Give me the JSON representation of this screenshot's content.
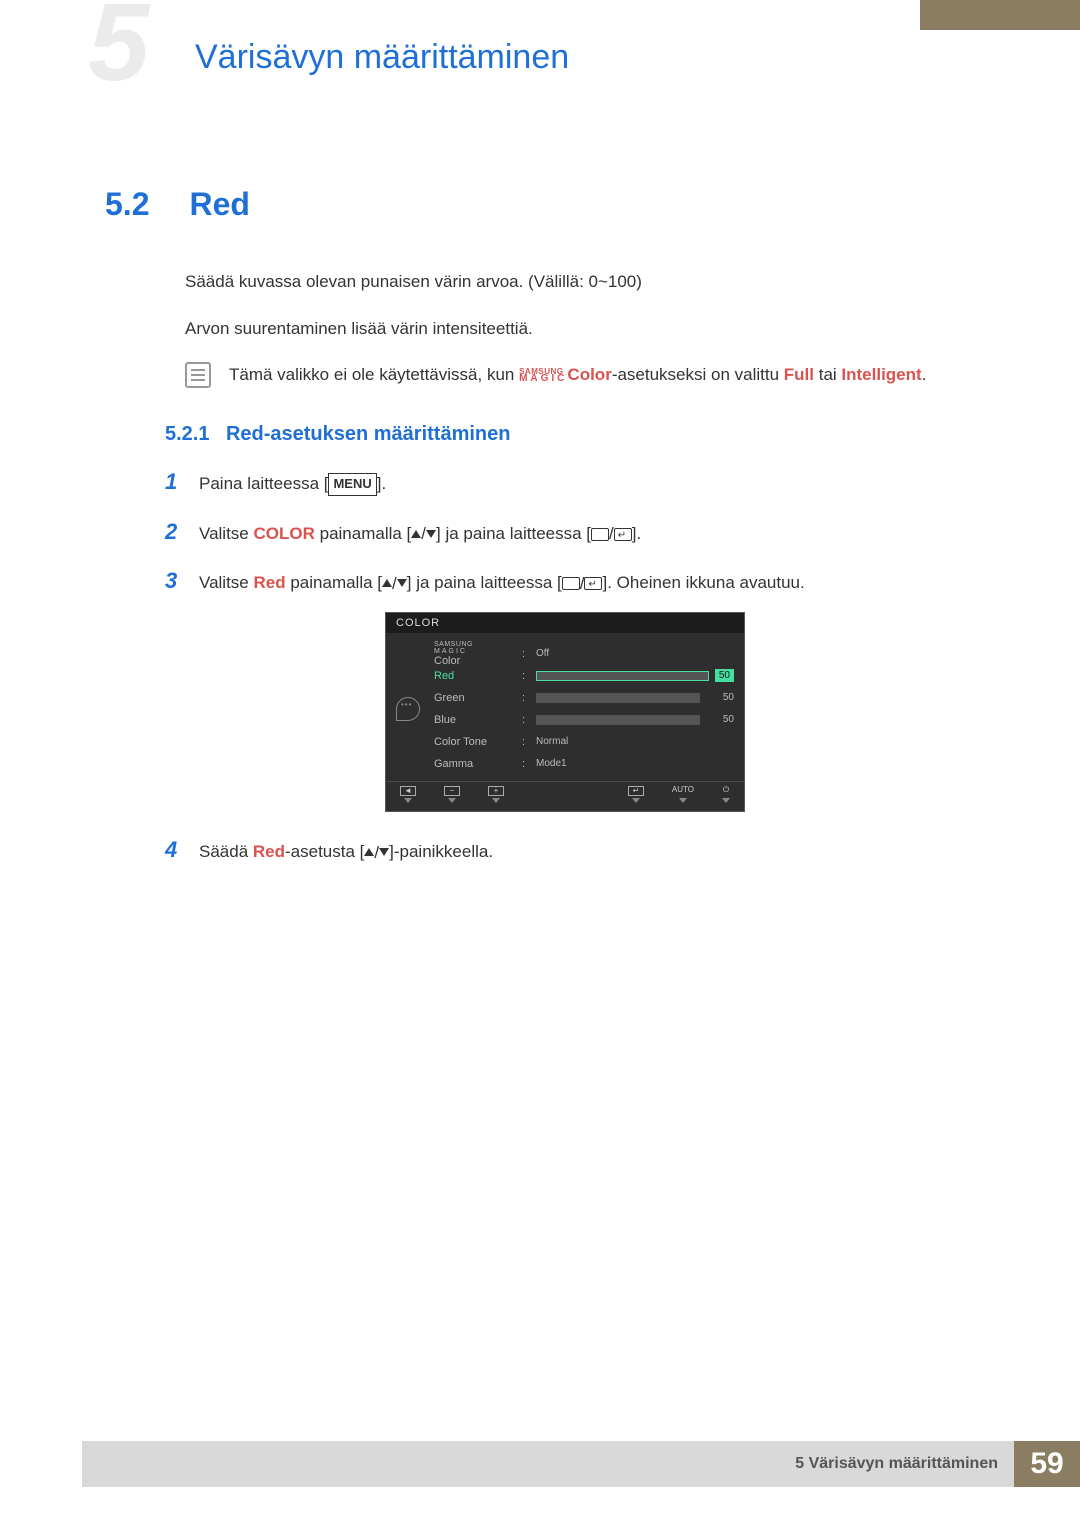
{
  "header": {
    "chapter_ghost": "5",
    "chapter_title": "Värisävyn määrittäminen"
  },
  "section": {
    "number": "5.2",
    "title": "Red",
    "para1": "Säädä kuvassa olevan punaisen värin arvoa. (Välillä: 0~100)",
    "para2": "Arvon suurentaminen lisää värin intensiteettiä.",
    "note_pre": "Tämä valikko ei ole käytettävissä, kun ",
    "note_magic_top": "SAMSUNG",
    "note_magic_bot": "MAGIC",
    "note_color": "Color",
    "note_mid": "-asetukseksi on valittu ",
    "note_full": "Full",
    "note_tai": " tai ",
    "note_intel": "Intelligent",
    "note_end": "."
  },
  "subsection": {
    "number": "5.2.1",
    "title": "Red-asetuksen määrittäminen"
  },
  "steps": {
    "s1_num": "1",
    "s1_a": "Paina laitteessa [",
    "s1_menu": "MENU",
    "s1_b": "].",
    "s2_num": "2",
    "s2_a": "Valitse ",
    "s2_kw": "COLOR",
    "s2_b": " painamalla [",
    "s2_c": "] ja paina laitteessa [",
    "s2_d": "].",
    "s3_num": "3",
    "s3_a": "Valitse ",
    "s3_kw": "Red",
    "s3_b": " painamalla [",
    "s3_c": "] ja paina laitteessa [",
    "s3_d": "]. Oheinen ikkuna avautuu.",
    "s4_num": "4",
    "s4_a": "Säädä ",
    "s4_kw": "Red",
    "s4_b": "-asetusta [",
    "s4_c": "]-painikkeella."
  },
  "osd": {
    "title": "COLOR",
    "magic_top": "SAMSUNG",
    "magic_bot": "MAGIC",
    "magic_suffix": " Color",
    "rows": {
      "magic_val": "Off",
      "red_label": "Red",
      "red_val": "50",
      "green_label": "Green",
      "green_val": "50",
      "blue_label": "Blue",
      "blue_val": "50",
      "tone_label": "Color Tone",
      "tone_val": "Normal",
      "gamma_label": "Gamma",
      "gamma_val": "Mode1"
    },
    "footer": {
      "auto": "AUTO"
    }
  },
  "footer": {
    "text": "5 Värisävyn määrittäminen",
    "page": "59"
  }
}
